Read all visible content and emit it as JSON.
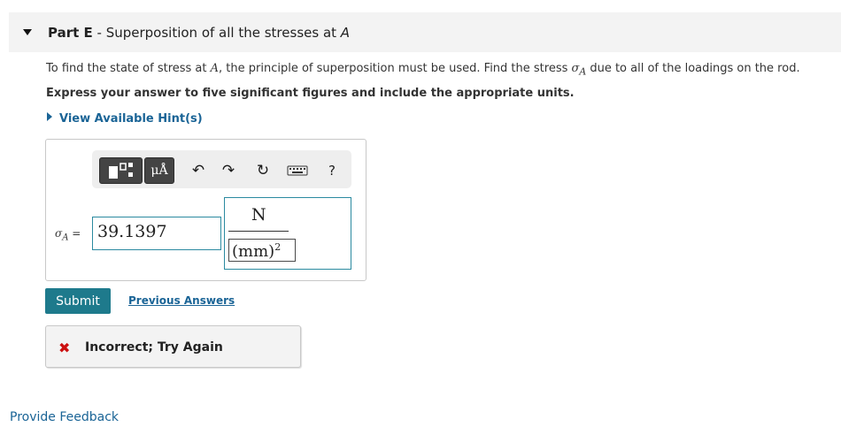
{
  "part": {
    "label": "Part E",
    "separator": " - ",
    "title_text": "Superposition of all the stresses at ",
    "title_point": "A"
  },
  "prompt": {
    "text1": "To find the state of stress at ",
    "point": "A",
    "text2": ", the principle of superposition must be used. Find the stress ",
    "symbol": "σ",
    "subscript": "A",
    "text3": " due to all of the loadings on the rod."
  },
  "instruction": "Express your answer to five significant figures and include the appropriate units.",
  "hint_link": "View Available Hint(s)",
  "toolbar": {
    "units_button": "μÅ",
    "undo_glyph": "↶",
    "redo_glyph": "↷",
    "reset_glyph": "↻",
    "help_button": "?"
  },
  "answer": {
    "variable_symbol": "σ",
    "variable_subscript": "A",
    "equals": " = ",
    "value": "39.1397",
    "unit_numerator": "N",
    "unit_denominator": "(mm)",
    "unit_denominator_exponent": "2"
  },
  "submit_label": "Submit",
  "previous_answers_label": "Previous Answers",
  "feedback": {
    "icon": "✖",
    "text": "Incorrect; Try Again"
  },
  "provide_feedback": "Provide Feedback",
  "colors": {
    "accent": "#1e7a8c",
    "link": "#1a6496",
    "error": "#cc1111"
  }
}
